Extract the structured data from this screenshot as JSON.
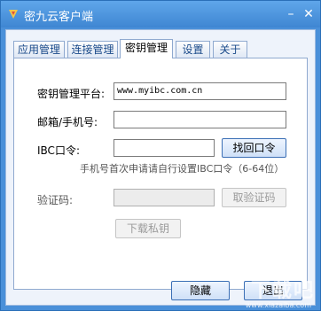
{
  "window": {
    "title": "密九云客户端"
  },
  "tabs": [
    "应用管理",
    "连接管理",
    "密钥管理",
    "设置",
    "关于"
  ],
  "form": {
    "platform_label": "密钥管理平台:",
    "platform_value": "www.myibc.com.cn",
    "phone_label": "邮箱/手机号:",
    "phone_value": "",
    "ibc_label": "IBC口令:",
    "ibc_value": "",
    "retrieve_label": "找回口令",
    "hint": "手机号首次申请请自行设置IBC口令（6-64位）",
    "code_label": "验证码:",
    "code_value": "",
    "get_code_label": "取验证码",
    "download_label": "下载私钥"
  },
  "footer": {
    "hide_label": "隐藏",
    "exit_label": "退出"
  },
  "watermark": {
    "text": "下载吧",
    "url": "www.xiazaiba.com"
  }
}
